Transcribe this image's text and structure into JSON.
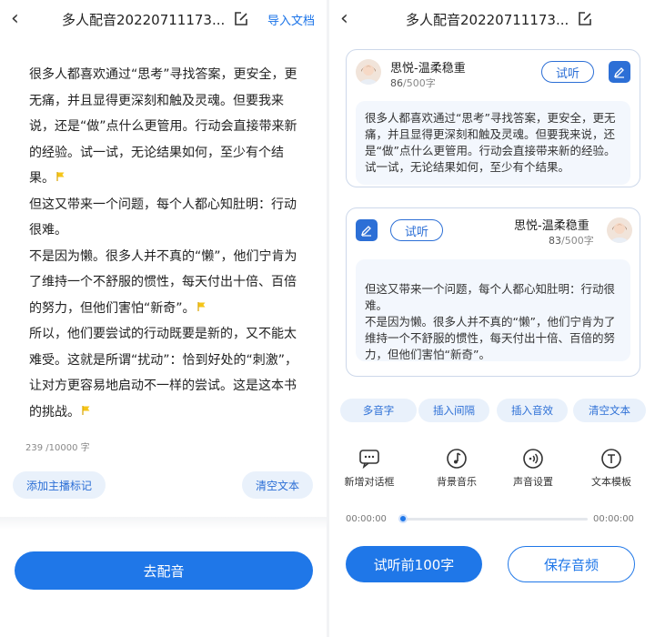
{
  "left": {
    "title": "多人配音20220711173...",
    "import_label": "导入文档",
    "paragraphs": [
      "很多人都喜欢通过“思考”寻找答案，更安全，更无痛，并且显得更深刻和触及灵魂。但要我来说，还是“做”点什么更管用。行动会直接带来新的经验。试一试，无论结果如何，至少有个结果。",
      "但这又带来一个问题，每个人都心知肚明：行动很难。",
      "不是因为懒。很多人并不真的“懒”，他们宁肯为了维持一个不舒服的惯性，每天付出十倍、百倍的努力，但他们害怕“新奇”。",
      "所以，他们要尝试的行动既要是新的，又不能太难受。这就是所谓“扰动”：恰到好处的“刺激”，让对方更容易地启动不一样的尝试。这是这本书的挑战。"
    ],
    "counter": "239 /10000 字",
    "add_mark_label": "添加主播标记",
    "clear_label": "清空文本",
    "go_dub_label": "去配音"
  },
  "right": {
    "title": "多人配音20220711173...",
    "cards": [
      {
        "voice_name": "思悦-温柔稳重",
        "count": "86",
        "limit": "/500字",
        "listen_label": "试听",
        "text": "很多人都喜欢通过“思考”寻找答案，更安全，更无痛，并且显得更深刻和触及灵魂。但要我来说，还是“做”点什么更管用。行动会直接带来新的经验。试一试，无论结果如何，至少有个结果。"
      },
      {
        "voice_name": "思悦-温柔稳重",
        "count": "83",
        "limit": "/500字",
        "listen_label": "试听",
        "text": "但这又带来一个问题，每个人都心知肚明：行动很难。\n不是因为懒。很多人并不真的“懒”，他们宁肯为了维持一个不舒服的惯性，每天付出十倍、百倍的努力，但他们害怕“新奇”。"
      }
    ],
    "chips": [
      "多音字",
      "插入间隔",
      "插入音效",
      "清空文本"
    ],
    "tools": [
      "新增对话框",
      "背景音乐",
      "声音设置",
      "文本模板"
    ],
    "time_start": "00:00:00",
    "time_end": "00:00:00",
    "progress": 0,
    "preview_label": "试听前100字",
    "save_label": "保存音频"
  },
  "colors": {
    "accent": "#1f77e8",
    "pill_bg": "#e9f1fb",
    "flag": "#f5c518"
  }
}
